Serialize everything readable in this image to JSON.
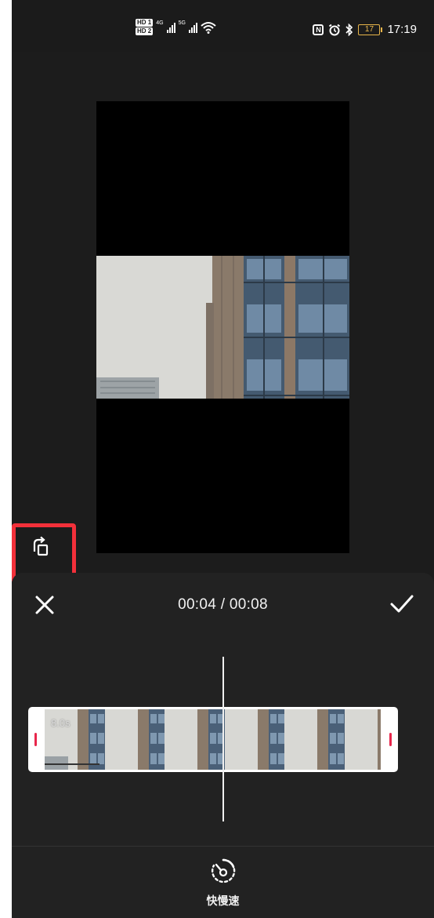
{
  "status_bar": {
    "left_badges": [
      "HD 1",
      "HD 2"
    ],
    "network_1": "4G",
    "network_2": "5G",
    "nfc_label": "N",
    "battery_level": "17",
    "time": "17:19",
    "icons": [
      "signal-icon",
      "wifi-icon",
      "nfc-icon",
      "alarm-icon",
      "bluetooth-icon",
      "battery-icon"
    ]
  },
  "editor": {
    "time_display": "00:04 / 00:08",
    "close_icon": "close-icon",
    "confirm_icon": "checkmark-icon",
    "rotate_icon": "rotate-icon"
  },
  "timeline": {
    "duration_label": "8.0s",
    "frame_count": 6,
    "accent_color": "#e8264b",
    "playhead_progress": 0.5
  },
  "toolbar": {
    "speed_label": "快慢速",
    "speed_icon": "speed-icon"
  },
  "colors": {
    "background": "#1c1c1c",
    "panel": "#222222",
    "highlight": "#f2303a"
  }
}
